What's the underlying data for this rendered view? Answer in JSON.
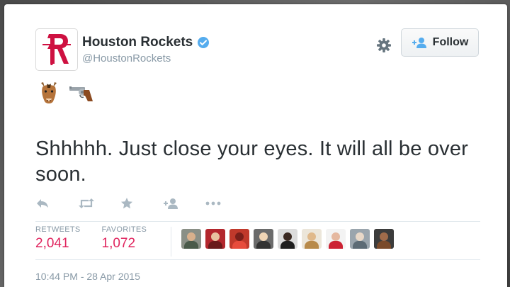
{
  "account": {
    "name": "Houston Rockets",
    "handle": "@HoustonRockets"
  },
  "header": {
    "follow_label": "Follow"
  },
  "tweet": {
    "text": "Shhhhh. Just close your eyes. It will all be over soon.",
    "emojis": [
      "horse-face-icon",
      "pistol-icon"
    ],
    "timestamp": "10:44 PM - 28 Apr 2015"
  },
  "stats": {
    "retweets_label": "RETWEETS",
    "retweets_value": "2,041",
    "favorites_label": "FAVORITES",
    "favorites_value": "1,072"
  },
  "colors": {
    "text": "#292f33",
    "muted": "#8899a6",
    "stat_value": "#e0245e",
    "brand_red": "#ce1141",
    "verified_blue": "#55acee"
  },
  "favoriters": [
    {
      "name": "favoriter-avatar-1",
      "bg": "#8a8f86",
      "head": "#d9b08c",
      "body": "#4a5a4a"
    },
    {
      "name": "favoriter-avatar-2",
      "bg": "#b3272d",
      "head": "#e8c3a0",
      "body": "#6a1a1a"
    },
    {
      "name": "favoriter-avatar-3",
      "bg": "#c0392b",
      "head": "#7a1f1a",
      "body": "#e74c3c"
    },
    {
      "name": "favoriter-avatar-4",
      "bg": "#6b6b6b",
      "head": "#f0d5b5",
      "body": "#333333"
    },
    {
      "name": "favoriter-avatar-5",
      "bg": "#dcdcdc",
      "head": "#3b2a22",
      "body": "#1f1f1f"
    },
    {
      "name": "favoriter-avatar-6",
      "bg": "#ece6da",
      "head": "#e0b98b",
      "body": "#b88a4a"
    },
    {
      "name": "favoriter-avatar-7",
      "bg": "#f3f3f3",
      "head": "#e5b8a0",
      "body": "#cc2233"
    },
    {
      "name": "favoriter-avatar-8",
      "bg": "#9aa5ad",
      "head": "#e8d8c8",
      "body": "#5c6b75"
    },
    {
      "name": "favoriter-avatar-9",
      "bg": "#3c3c3c",
      "head": "#a06b4a",
      "body": "#7a4a2a"
    }
  ]
}
